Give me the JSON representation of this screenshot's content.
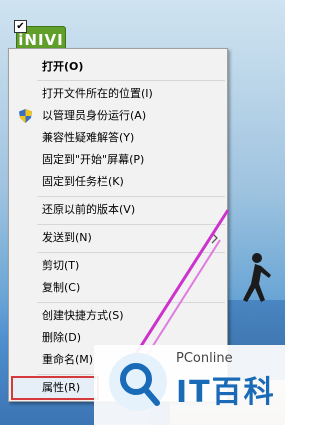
{
  "desktop_icon": {
    "name": "iNIVI",
    "checkbox": "✔"
  },
  "context_menu": {
    "items": [
      {
        "label": "打开(O)",
        "bold": true
      },
      {
        "label": "打开文件所在的位置(I)"
      },
      {
        "label": "以管理员身份运行(A)",
        "icon": "uac-shield-icon"
      },
      {
        "label": "兼容性疑难解答(Y)"
      },
      {
        "label": "固定到\"开始\"屏幕(P)"
      },
      {
        "label": "固定到任务栏(K)"
      },
      {
        "label": "还原以前的版本(V)"
      },
      {
        "label": "发送到(N)",
        "submenu": true
      },
      {
        "label": "剪切(T)"
      },
      {
        "label": "复制(C)"
      },
      {
        "label": "创建快捷方式(S)"
      },
      {
        "label": "删除(D)"
      },
      {
        "label": "重命名(M)"
      },
      {
        "label": "属性(R)",
        "highlighted": true
      }
    ]
  },
  "watermark": {
    "brand": "PConline",
    "name": "IT百科"
  },
  "colors": {
    "highlight_border": "#d63939",
    "annotation_arrow": "#cc33cc",
    "icon_green": "#5f9f2a"
  }
}
